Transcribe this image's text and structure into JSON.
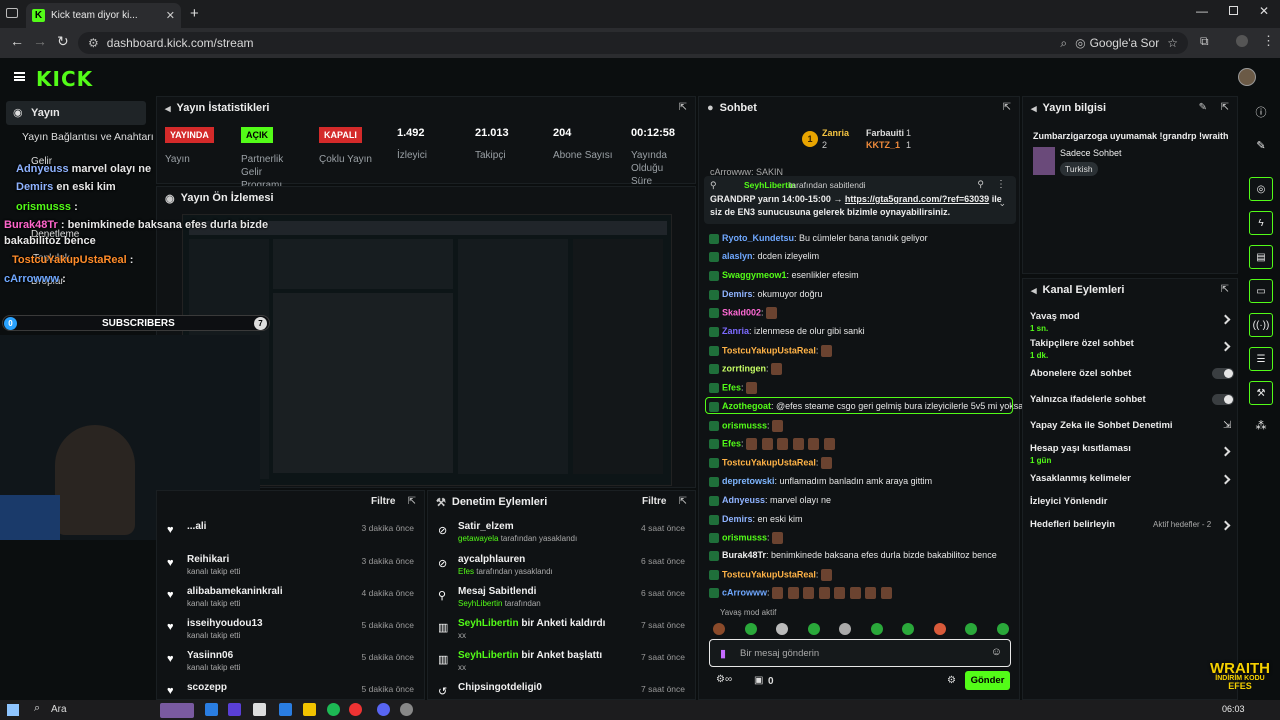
{
  "browser": {
    "tab_title": "Kick team diyor ki...",
    "url": "dashboard.kick.com/stream",
    "google_btn": "Google'a Sor"
  },
  "nav": {
    "active_item": "Yayın",
    "items": [
      "Yayın Bağlantısı ve Anahtarı",
      "Gelir",
      "Denetleme",
      "Topluluk",
      "Droplar"
    ]
  },
  "stats": {
    "title": "Yayın İstatistikleri",
    "badges": [
      {
        "label": "YAYINDA",
        "sub": "Yayın",
        "color": "#d42a2a"
      },
      {
        "label": "AÇIK",
        "sub": "Partnerlik Gelir Programı",
        "color": "#53fc18"
      },
      {
        "label": "KAPALI",
        "sub": "Çoklu Yayın",
        "color": "#d42a2a"
      }
    ],
    "viewers": {
      "value": "1.492",
      "label": "İzleyici"
    },
    "followers": {
      "value": "21.013",
      "label": "Takipçi"
    },
    "subs": {
      "value": "204",
      "label": "Abone Sayısı"
    },
    "uptime": {
      "value": "00:12:58",
      "label": "Yayında Olduğu Süre"
    }
  },
  "preview": {
    "title": "Yayın Ön İzlemesi"
  },
  "activity": {
    "filter": "Filtre",
    "rows": [
      {
        "name": "...ali",
        "sub": "",
        "time": "3 dakika önce"
      },
      {
        "name": "Reihikari",
        "sub": "kanalı takip etti",
        "time": "3 dakika önce"
      },
      {
        "name": "alibabamekaninkrali",
        "sub": "kanalı takip etti",
        "time": "4 dakika önce"
      },
      {
        "name": "isseihyoudou13",
        "sub": "kanalı takip etti",
        "time": "5 dakika önce"
      },
      {
        "name": "Yasiinn06",
        "sub": "kanalı takip etti",
        "time": "5 dakika önce"
      },
      {
        "name": "scozepp",
        "sub": "",
        "time": "5 dakika önce"
      }
    ]
  },
  "moderation": {
    "title": "Denetim Eylemleri",
    "filter": "Filtre",
    "rows": [
      {
        "name": "Satir_elzem",
        "actor": "getawayela",
        "sub": " tarafından yasaklandı",
        "time": "4 saat önce"
      },
      {
        "name": "aycalphlauren",
        "actor": "Efes",
        "sub": " tarafından yasaklandı",
        "time": "6 saat önce"
      },
      {
        "name": "Mesaj Sabitlendi",
        "actor": "SeyhLibertin",
        "sub": " tarafından",
        "time": "6 saat önce"
      },
      {
        "name_hl": "SeyhLibertin",
        "name": " bir Anketi kaldırdı",
        "sub": "xx",
        "time": "7 saat önce"
      },
      {
        "name_hl": "SeyhLibertin",
        "name": " bir Anket başlattı",
        "sub": "xx",
        "time": "7 saat önce"
      },
      {
        "name": "Chipsingotdeligi0",
        "sub": "",
        "time": "7 saat önce"
      }
    ]
  },
  "chat": {
    "title": "Sohbet",
    "top": {
      "first": "Zanria",
      "first_count": "2",
      "second": "Farbauiti",
      "second_count": "1",
      "third": "KKTZ_1",
      "third_count": "1",
      "rank": "1"
    },
    "cut": "cArrowww: SAKIN",
    "pinned": {
      "by_user": "SeyhLibertin",
      "by": " tarafından sabitlendi",
      "text1": "GRANDRP yarın 14:00-15:00 → ",
      "link": "https://gta5grand.com/?ref=63039",
      "text2": " ile",
      "text3": "siz de EN3 sunucusuna gelerek bizimle oynayabilirsiniz."
    },
    "messages": [
      {
        "user": "Ryoto_Kundetsu",
        "color": "#6fa8ff",
        "text": " Bu cümleler bana tanıdık geliyor"
      },
      {
        "user": "alaslyn",
        "color": "#6fa8ff",
        "text": " dcden izleyelim"
      },
      {
        "user": "Swaggymeow1",
        "color": "#53fc18",
        "text": " esenlikler efesim"
      },
      {
        "user": "Demirs",
        "color": "#8fb3ff",
        "text": " okumuyor doğru"
      },
      {
        "user": "Skald002",
        "color": "#ff6ad5",
        "text": ""
      },
      {
        "user": "Zanria",
        "color": "#7d6bff",
        "text": " izlenmese de olur gibi sanki"
      },
      {
        "user": "TostcuYakupUstaReal",
        "color": "#ffb347",
        "text": ""
      },
      {
        "user": "zorrtingen",
        "color": "#c8ff66",
        "text": ""
      },
      {
        "user": "Efes",
        "color": "#53fc18",
        "text": ""
      },
      {
        "user": "Azothegoat",
        "color": "#53fc18",
        "text": " @efes steame csgo geri gelmiş bura izleyicilerle 5v5 mi yoksa"
      },
      {
        "user": "orismusss",
        "color": "#53fc18",
        "text": ""
      },
      {
        "user": "Efes",
        "color": "#53fc18",
        "text": ""
      },
      {
        "user": "TostcuYakupUstaReal",
        "color": "#ffb347",
        "text": ""
      },
      {
        "user": "depretowski",
        "color": "#7fb6ff",
        "text": " unflamadım banladın amk araya gittim"
      },
      {
        "user": "Adnyeuss",
        "color": "#8fb3ff",
        "text": " marvel olayı ne"
      },
      {
        "user": "Demirs",
        "color": "#8fb3ff",
        "text": " en eski kim"
      },
      {
        "user": "orismusss",
        "color": "#53fc18",
        "text": ""
      },
      {
        "user": "Burak48Tr",
        "color": "#f0f0f0",
        "text": " benimkinede baksana efes durla bizde bakabilitoz bence"
      },
      {
        "user": "TostcuYakupUstaReal",
        "color": "#ffb347",
        "text": ""
      },
      {
        "user": "cArrowww",
        "color": "#6fa8ff",
        "text": ""
      }
    ],
    "slowmode": "Yavaş mod aktif",
    "placeholder": "Bir mesaj gönderin",
    "send": "Gönder",
    "points": "0"
  },
  "info": {
    "title": "Yayın bilgisi",
    "stream_title": "Zumbarzigarzoga uyumamak !grandrp !wraith",
    "category": "Sadece Sohbet",
    "tag": "Turkish"
  },
  "channel_actions": {
    "title": "Kanal Eylemleri",
    "items": [
      {
        "label": "Yavaş mod",
        "sub": "1 sn."
      },
      {
        "label": "Takipçilere özel sohbet",
        "sub": "1 dk."
      },
      {
        "label": "Abonelere özel sohbet",
        "sub": ""
      },
      {
        "label": "Yalnızca ifadelerle sohbet",
        "sub": ""
      },
      {
        "label": "Yapay Zeka ile Sohbet Denetimi",
        "sub": ""
      },
      {
        "label": "Hesap yaşı kısıtlaması",
        "sub": "1 gün"
      },
      {
        "label": "Yasaklanmış kelimeler",
        "sub": ""
      },
      {
        "label": "İzleyici Yönlendir",
        "sub": ""
      },
      {
        "label": "Hedefleri belirleyin",
        "sub": "",
        "status": "Aktif hedefler - 2"
      }
    ]
  },
  "overlay": {
    "lines": [
      {
        "user": "Adnyeuss",
        "text": " marvel olayı ne",
        "color": "#8fb3ff"
      },
      {
        "user": "Demirs",
        "text": " en eski kim",
        "color": "#8fb3ff"
      },
      {
        "user": "orismusss",
        "text": " :",
        "color": "#53fc18"
      },
      {
        "user": "Burak48Tr",
        "text": " : benimkinede baksana efes durla bizde",
        "color": "#ff66cc"
      },
      {
        "user": "",
        "text": "bakabilitoz bence",
        "color": "#fff"
      },
      {
        "user": "TostcuYakupUstaReal",
        "text": " :",
        "color": "#ff8c2a"
      },
      {
        "user": "cArrowww",
        "text": " :",
        "color": "#6fa8ff"
      }
    ],
    "subs_label": "SUBSCRIBERS",
    "subs_left": "0",
    "subs_right": "7",
    "wraith": "WRAITH",
    "wraith_sub": "İNDİRİM KODU",
    "wraith_sub2": "EFES"
  },
  "taskbar": {
    "search": "Ara",
    "time": "06:03"
  }
}
